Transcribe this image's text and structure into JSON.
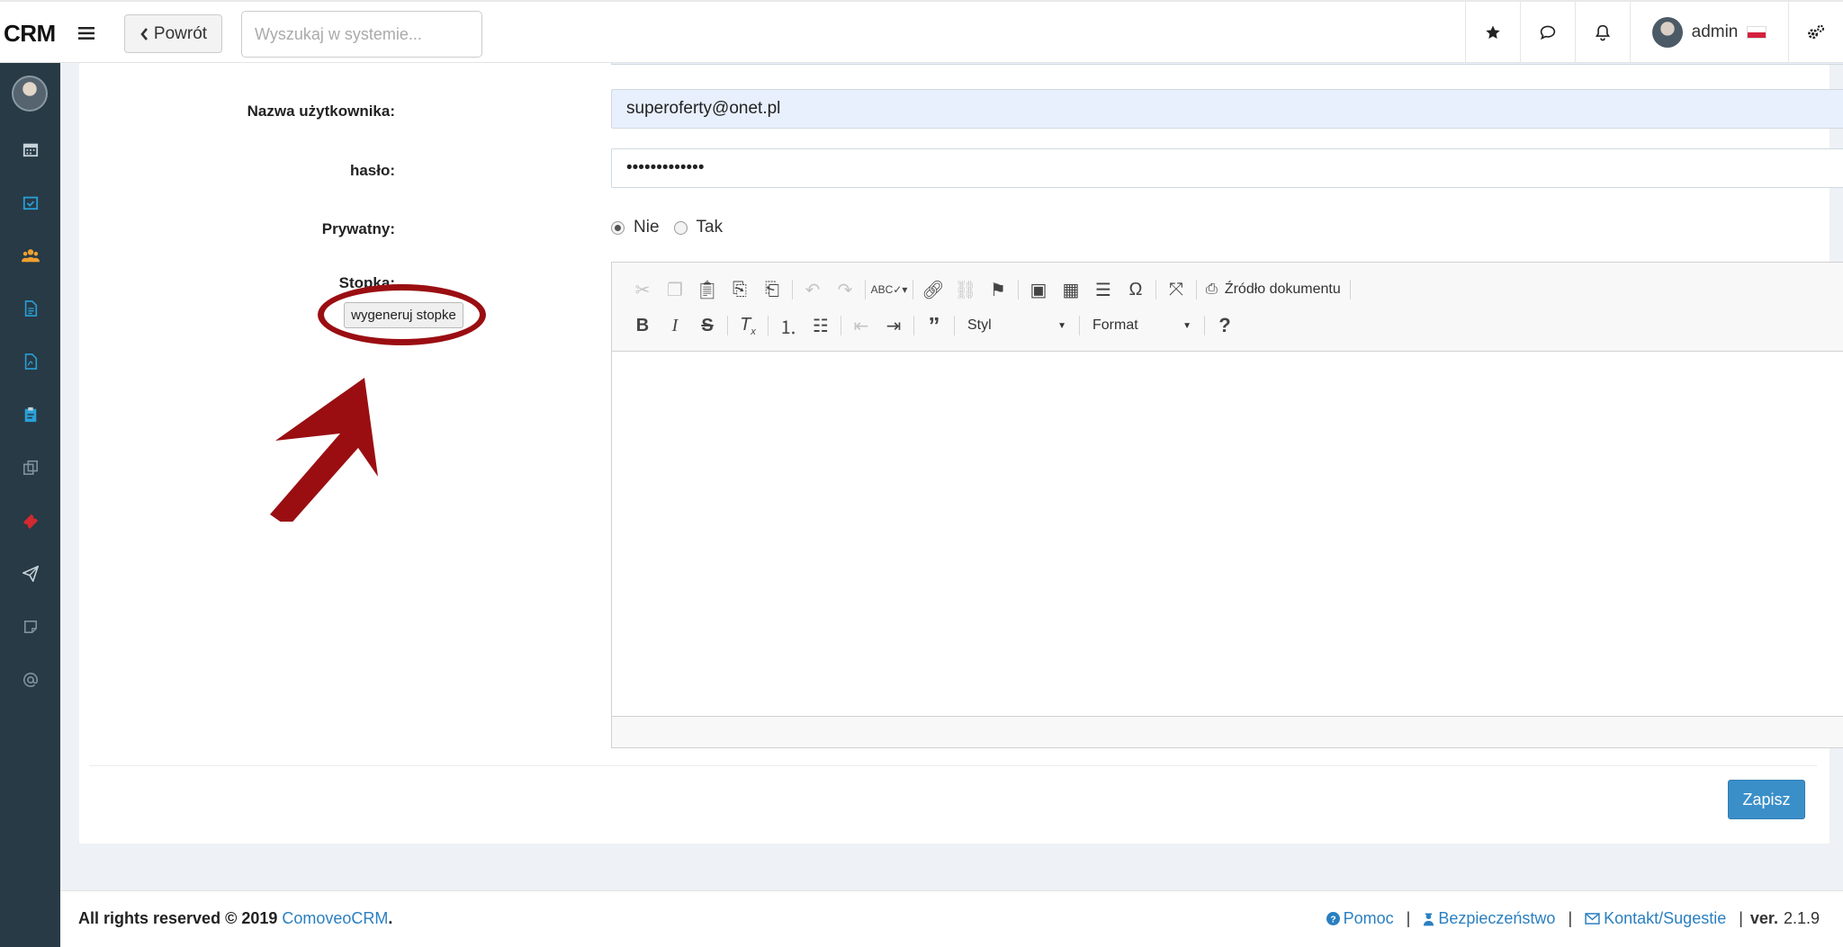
{
  "header": {
    "brand": "CRM",
    "back_label": "Powrót",
    "search_placeholder": "Wyszukaj w systemie...",
    "user_name": "admin"
  },
  "form": {
    "username_label": "Nazwa użytkownika:",
    "username_value": "superoferty@onet.pl",
    "password_label": "hasło:",
    "password_value": "•••••••••••••",
    "private_label": "Prywatny:",
    "private_options": [
      "Nie",
      "Tak"
    ],
    "private_selected": "Nie",
    "footer_label": "Stopka:",
    "generate_button": "wygeneruj stopke",
    "save_button": "Zapisz"
  },
  "editor": {
    "source_label": "Źródło dokumentu",
    "style_combo": "Styl",
    "format_combo": "Format"
  },
  "footer": {
    "copyright": "All rights reserved © 2019",
    "company_link": "ComoveoCRM",
    "help": "Pomoc",
    "security": "Bezpieczeństwo",
    "contact": "Kontakt/Sugestie",
    "version_label": "ver.",
    "version": "2.1.9"
  },
  "colors": {
    "sidebar_bg": "#273a45",
    "accent": "#3a8fc9",
    "annotation": "#9a0e12"
  }
}
